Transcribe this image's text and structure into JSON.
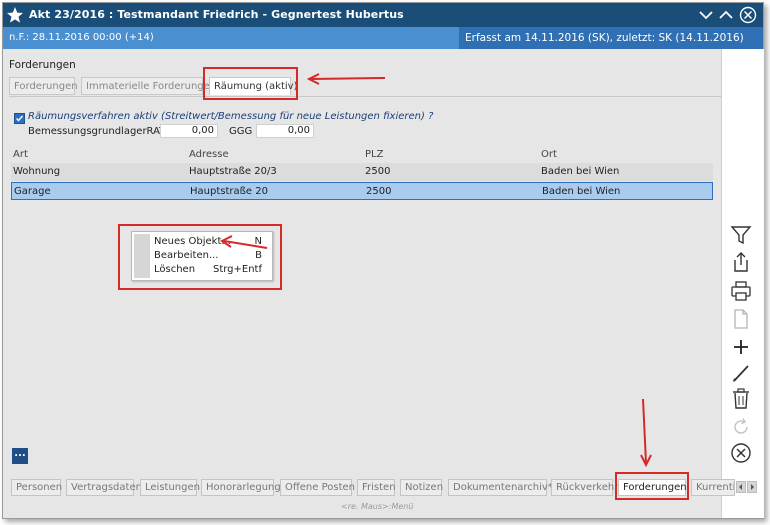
{
  "window": {
    "title": "Akt 23/2016 : Testmandant Friedrich - Gegnertest Hubertus",
    "info_left": "n.F.: 28.11.2016 00:00 (+14)",
    "info_right": "Erfasst am 14.11.2016 (SK), zuletzt: SK (14.11.2016)"
  },
  "section": {
    "title": "Forderungen"
  },
  "tabs": [
    {
      "label": "Forderungen"
    },
    {
      "label": "Immaterielle Forderungen"
    },
    {
      "label": "Räumung (aktiv)",
      "active": true
    }
  ],
  "raeumung": {
    "checkbox_label": "Räumungsverfahren aktiv (Streitwert/Bemessung für neue Leistungen fixieren) ?",
    "checked": true,
    "ratg_label": "BemessungsgrundlagerRATG",
    "ratg_value": "0,00",
    "ggg_label": "GGG",
    "ggg_value": "0,00"
  },
  "table": {
    "headers": [
      "Art",
      "Adresse",
      "PLZ",
      "Ort"
    ],
    "rows": [
      [
        "Wohnung",
        "Hauptstraße 20/3",
        "2500",
        "Baden bei Wien"
      ],
      [
        "Garage",
        "Hauptstraße 20",
        "2500",
        "Baden bei Wien"
      ]
    ]
  },
  "context_menu": [
    {
      "label": "Neues Objekt...",
      "key": "N"
    },
    {
      "label": "Bearbeiten...",
      "key": "B"
    },
    {
      "label": "Löschen",
      "key": "Strg+Entf"
    }
  ],
  "more_button": "...",
  "bottom_tabs": [
    "Personen",
    "Vertragsdaten",
    "Leistungen",
    "Honorarlegung",
    "Offene Posten",
    "Fristen",
    "Notizen",
    "Dokumentenarchiv*",
    "Rückverkehr",
    "Forderungen",
    "Kurrentie"
  ],
  "active_bottom_tab": "Forderungen",
  "hint": "<re. Maus>:Menü",
  "toolbar_icons": [
    "filter-icon",
    "export-icon",
    "print-icon",
    "document-icon",
    "add-icon",
    "edit-icon",
    "delete-icon",
    "refresh-icon",
    "cancel-icon"
  ],
  "colors": {
    "titlebar": "#1a4e78",
    "infobar": "#4a8fd0",
    "selection": "#a9cbee",
    "annotation": "#d42a2a"
  }
}
